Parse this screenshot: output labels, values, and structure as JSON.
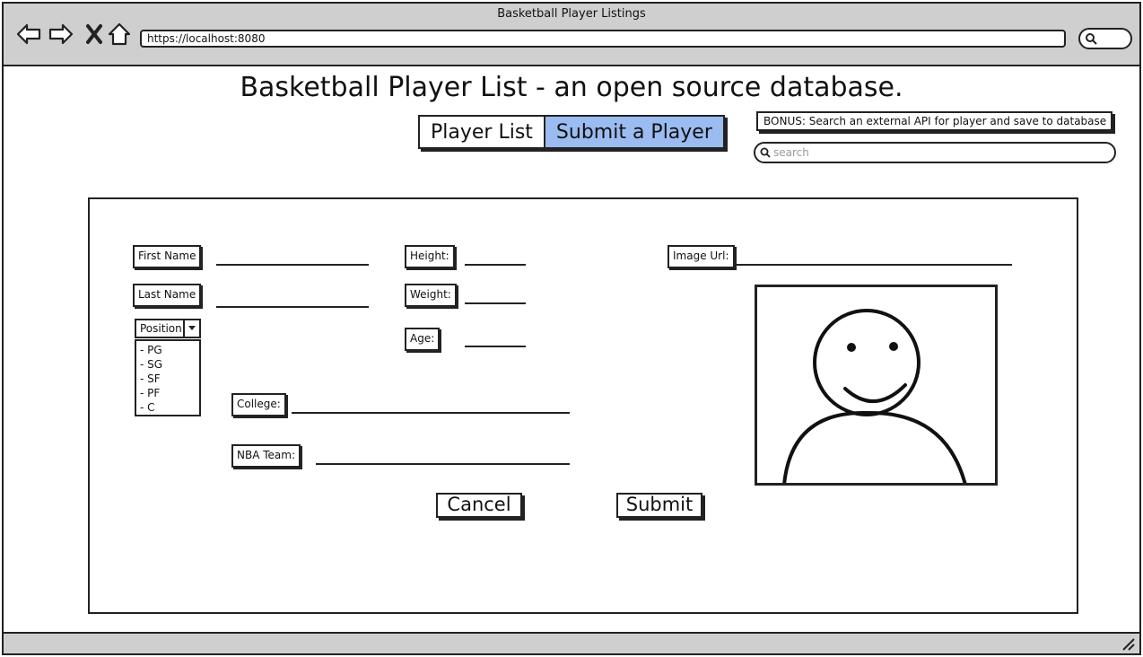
{
  "window": {
    "title": "Basketball Player Listings"
  },
  "browser": {
    "url": "https://localhost:8080"
  },
  "page": {
    "title": "Basketball Player List - an open source database."
  },
  "tabs": [
    {
      "label": "Player List",
      "active": false
    },
    {
      "label": "Submit a Player",
      "active": true
    }
  ],
  "bonus": {
    "label": "BONUS: Search an external API for player and save to database",
    "search_placeholder": "search"
  },
  "form": {
    "first_name_label": "First Name",
    "last_name_label": "Last Name",
    "position_label": "Position",
    "position_options": [
      "- PG",
      "- SG",
      "- SF",
      "- PF",
      "- C"
    ],
    "height_label": "Height:",
    "weight_label": "Weight:",
    "age_label": "Age:",
    "college_label": "College:",
    "nba_team_label": "NBA Team:",
    "image_url_label": "Image Url:",
    "cancel_label": "Cancel",
    "submit_label": "Submit"
  },
  "colors": {
    "active_tab": "#9bbcf1",
    "chrome": "#cfcfcf"
  }
}
